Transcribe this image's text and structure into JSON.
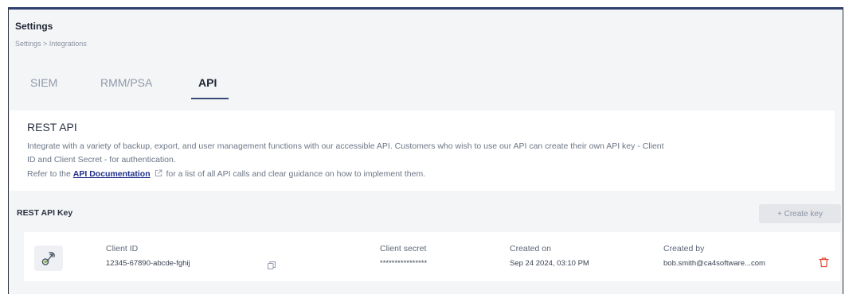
{
  "header": {
    "title": "Settings",
    "breadcrumb": "Settings > Integrations"
  },
  "tabs": [
    {
      "label": "SIEM",
      "active": false
    },
    {
      "label": "RMM/PSA",
      "active": false
    },
    {
      "label": "API",
      "active": true
    }
  ],
  "info_card": {
    "title": "REST API",
    "line1": "Integrate with a variety of backup, export, and user management functions with our accessible API. Customers who wish to use our API can create their own API key - Client",
    "line2": "ID and Client Secret - for authentication.",
    "line3_prefix": "Refer to the ",
    "link_text": "API Documentation",
    "line3_suffix": " for a list of all API calls and clear guidance on how to implement them."
  },
  "api_key_section": {
    "title": "REST API Key",
    "create_button": "+ Create key",
    "key": {
      "client_id_label": "Client ID",
      "client_id_value": "12345-67890-abcde-fghij",
      "client_secret_label": "Client secret",
      "client_secret_value": "****************",
      "created_on_label": "Created on",
      "created_on_value": "Sep 24 2024, 03:10 PM",
      "created_by_label": "Created by",
      "created_by_value": "bob.smith@ca4software...com"
    }
  },
  "icons": {
    "key": "key-icon",
    "copy": "copy-icon",
    "delete": "trash-icon",
    "external_link": "external-link-icon"
  },
  "colors": {
    "accent": "#3a4b7a",
    "link": "#1e2f8c",
    "delete": "#e0453a",
    "key_icon_green": "#7fbf3f"
  }
}
